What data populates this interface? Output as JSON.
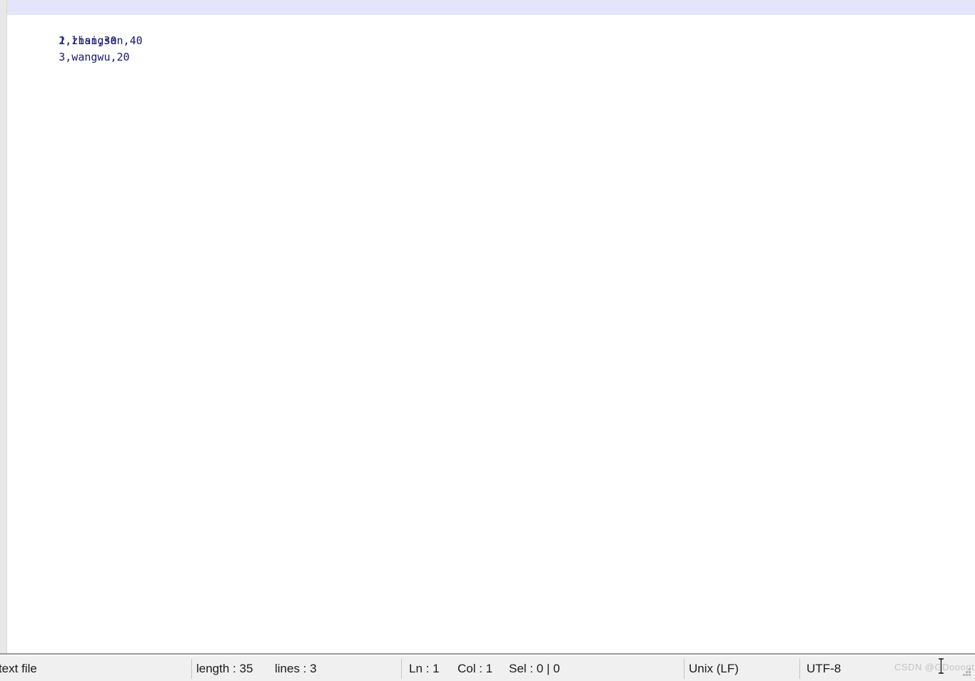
{
  "editor": {
    "lines": [
      {
        "text": "1,zhangsan,40",
        "current": true
      },
      {
        "text": "2,lisi,30",
        "current": false
      },
      {
        "text": "3,wangwu,20",
        "current": false
      }
    ],
    "current_line_highlight_color": "#e4e4fb",
    "text_color": "#191970",
    "background_color": "#ffffff"
  },
  "status_bar": {
    "document_type": "al text file",
    "length": "length : 35",
    "lines": "lines : 3",
    "ln": "Ln : 1",
    "col": "Col : 1",
    "sel": "Sel : 0 | 0",
    "eol": "Unix (LF)",
    "encoding": "UTF-8",
    "background_color": "#f0f0f0"
  },
  "watermark": {
    "text": "CSDN @GDoooot"
  }
}
